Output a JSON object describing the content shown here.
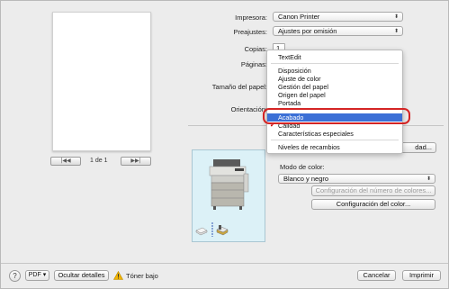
{
  "preview": {
    "page_indicator": "1 de 1",
    "first_glyph": "|◀◀",
    "prev_glyph": "◀",
    "next_glyph": "▶",
    "last_glyph": "▶▶|"
  },
  "form": {
    "printer_label": "Impresora:",
    "printer_value": "Canon Printer",
    "presets_label": "Preajustes:",
    "presets_value": "Ajustes por omisión",
    "copies_label": "Copias:",
    "copies_value": "1",
    "pages_label": "Páginas:",
    "paper_size_label": "Tamaño del papel:",
    "orientation_label": "Orientación:",
    "popup_arrows": "⬍"
  },
  "menu": {
    "items": [
      {
        "label": "TextEdit",
        "checked": false,
        "selected": false
      },
      {
        "label": "Disposición",
        "checked": false,
        "selected": false
      },
      {
        "label": "Ajuste de color",
        "checked": false,
        "selected": false
      },
      {
        "label": "Gestión del papel",
        "checked": false,
        "selected": false
      },
      {
        "label": "Origen del papel",
        "checked": false,
        "selected": false
      },
      {
        "label": "Portada",
        "checked": false,
        "selected": false
      },
      {
        "label": "Acabado",
        "checked": false,
        "selected": true
      },
      {
        "label": "Calidad",
        "checked": true,
        "selected": false
      },
      {
        "label": "Características especiales",
        "checked": false,
        "selected": false
      },
      {
        "label": "Niveles de recambios",
        "checked": false,
        "selected": false
      }
    ],
    "check_glyph": "✔"
  },
  "quality_panel": {
    "partial_button_label": "dad...",
    "color_mode_label": "Modo de color:",
    "color_mode_value": "Blanco y negro",
    "color_number_button": "Configuración del número de colores...",
    "color_config_button": "Configuración del color..."
  },
  "bottom": {
    "help_label": "?",
    "pdf_label": "PDF ▾",
    "hide_details_label": "Ocultar detalles",
    "toner_label": "Tóner bajo",
    "cancel_label": "Cancelar",
    "print_label": "Imprimir"
  },
  "colors": {
    "selection": "#3b6fd6",
    "highlight_ring": "#d42424",
    "warning": "#f2b500"
  }
}
